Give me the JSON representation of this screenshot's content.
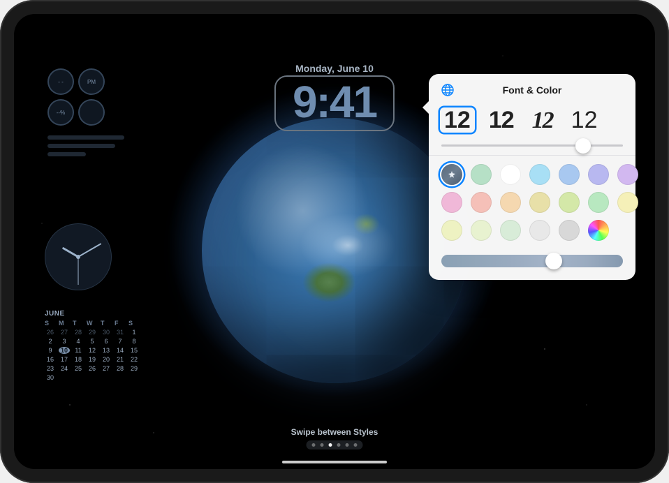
{
  "lockscreen": {
    "date": "Monday, June 10",
    "time": "9:41",
    "swipe_hint": "Swipe between Styles",
    "page_dots_total": 6,
    "page_dots_active": 2,
    "calendar": {
      "month_label": "JUNE",
      "day_headers": [
        "S",
        "M",
        "T",
        "W",
        "T",
        "F",
        "S"
      ],
      "leading_blanks": 0,
      "prev_days": [
        26,
        27,
        28,
        29,
        30,
        31
      ],
      "days": [
        1,
        2,
        3,
        4,
        5,
        6,
        7,
        8,
        9,
        10,
        11,
        12,
        13,
        14,
        15,
        16,
        17,
        18,
        19,
        20,
        21,
        22,
        23,
        24,
        25,
        26,
        27,
        28,
        29,
        30
      ],
      "today": 10
    },
    "complications": {
      "top_left": "- -",
      "top_right": "PM",
      "bottom_left": "--%",
      "bottom_right": ""
    }
  },
  "popover": {
    "title": "Font & Color",
    "globe_icon": "globe-icon",
    "fonts": [
      {
        "sample": "12",
        "selected": true
      },
      {
        "sample": "12",
        "selected": false
      },
      {
        "sample": "12",
        "selected": false
      },
      {
        "sample": "12",
        "selected": false
      }
    ],
    "weight_slider_pct": 78,
    "colors": [
      {
        "hex": "auto",
        "selected": true
      },
      {
        "hex": "#b6e0c6",
        "selected": false
      },
      {
        "hex": "#ffffff",
        "selected": false
      },
      {
        "hex": "#a8dff5",
        "selected": false
      },
      {
        "hex": "#a8c8f0",
        "selected": false
      },
      {
        "hex": "#b8b8f0",
        "selected": false
      },
      {
        "hex": "#d2b8f0",
        "selected": false
      },
      {
        "hex": "#f0b8d8",
        "selected": false
      },
      {
        "hex": "#f5c0b8",
        "selected": false
      },
      {
        "hex": "#f5d8b0",
        "selected": false
      },
      {
        "hex": "#e8e0a8",
        "selected": false
      },
      {
        "hex": "#d4e8a8",
        "selected": false
      },
      {
        "hex": "#b8e8c0",
        "selected": false
      },
      {
        "hex": "#f5f0b8",
        "selected": false
      },
      {
        "hex": "#eef2c2",
        "selected": false
      },
      {
        "hex": "#e8f2d0",
        "selected": false
      },
      {
        "hex": "#d8ecd8",
        "selected": false
      },
      {
        "hex": "#e8e8e8",
        "selected": false
      },
      {
        "hex": "#d8d8d8",
        "selected": false
      },
      {
        "hex": "rainbow",
        "selected": false
      }
    ],
    "hue_slider_pct": 62
  }
}
